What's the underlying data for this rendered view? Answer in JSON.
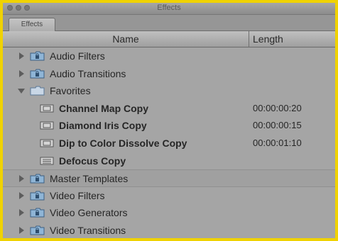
{
  "window": {
    "title": "Effects",
    "tab": "Effects"
  },
  "columns": {
    "name": "Name",
    "length": "Length"
  },
  "rows": [
    {
      "label": "Audio Filters",
      "type": "folder-locked",
      "state": "closed",
      "length": ""
    },
    {
      "label": "Audio Transitions",
      "type": "folder-locked",
      "state": "closed",
      "length": ""
    },
    {
      "label": "Favorites",
      "type": "folder",
      "state": "open",
      "length": ""
    },
    {
      "label": "Channel Map Copy",
      "type": "effect-item",
      "length": "00:00:00:20"
    },
    {
      "label": "Diamond Iris Copy",
      "type": "effect-item",
      "length": "00:00:00:15"
    },
    {
      "label": "Dip to Color Dissolve Copy",
      "type": "effect-item",
      "length": "00:00:01:10"
    },
    {
      "label": "Defocus Copy",
      "type": "filter-item",
      "length": ""
    },
    {
      "label": "Master Templates",
      "type": "folder-locked",
      "state": "closed",
      "length": ""
    },
    {
      "label": "Video Filters",
      "type": "folder-locked",
      "state": "closed",
      "length": ""
    },
    {
      "label": "Video Generators",
      "type": "folder-locked",
      "state": "closed",
      "length": ""
    },
    {
      "label": "Video Transitions",
      "type": "folder-locked",
      "state": "closed",
      "length": ""
    }
  ],
  "colors": {
    "highlight": "#f0d200",
    "background": "#a5a5a5",
    "text": "#262626"
  }
}
